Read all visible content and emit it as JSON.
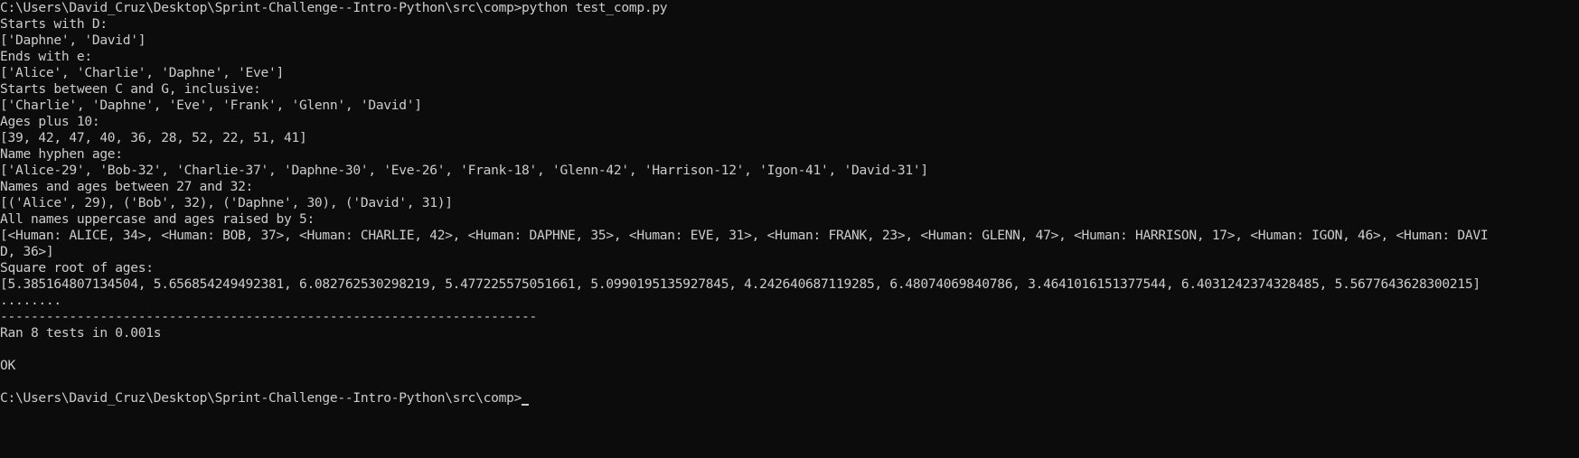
{
  "terminal": {
    "lines": [
      "C:\\Users\\David_Cruz\\Desktop\\Sprint-Challenge--Intro-Python\\src\\comp>python test_comp.py",
      "Starts with D:",
      "['Daphne', 'David']",
      "Ends with e:",
      "['Alice', 'Charlie', 'Daphne', 'Eve']",
      "Starts between C and G, inclusive:",
      "['Charlie', 'Daphne', 'Eve', 'Frank', 'Glenn', 'David']",
      "Ages plus 10:",
      "[39, 42, 47, 40, 36, 28, 52, 22, 51, 41]",
      "Name hyphen age:",
      "['Alice-29', 'Bob-32', 'Charlie-37', 'Daphne-30', 'Eve-26', 'Frank-18', 'Glenn-42', 'Harrison-12', 'Igon-41', 'David-31']",
      "Names and ages between 27 and 32:",
      "[('Alice', 29), ('Bob', 32), ('Daphne', 30), ('David', 31)]",
      "All names uppercase and ages raised by 5:",
      "[<Human: ALICE, 34>, <Human: BOB, 37>, <Human: CHARLIE, 42>, <Human: DAPHNE, 35>, <Human: EVE, 31>, <Human: FRANK, 23>, <Human: GLENN, 47>, <Human: HARRISON, 17>, <Human: IGON, 46>, <Human: DAVI",
      "D, 36>]",
      "Square root of ages:",
      "[5.385164807134504, 5.656854249492381, 6.082762530298219, 5.477225575051661, 5.0990195135927845, 4.242640687119285, 6.48074069840786, 3.4641016151377544, 6.4031242374328485, 5.5677643628300215]",
      "........",
      "----------------------------------------------------------------------",
      "Ran 8 tests in 0.001s",
      "",
      "OK",
      "",
      "C:\\Users\\David_Cruz\\Desktop\\Sprint-Challenge--Intro-Python\\src\\comp>"
    ]
  }
}
